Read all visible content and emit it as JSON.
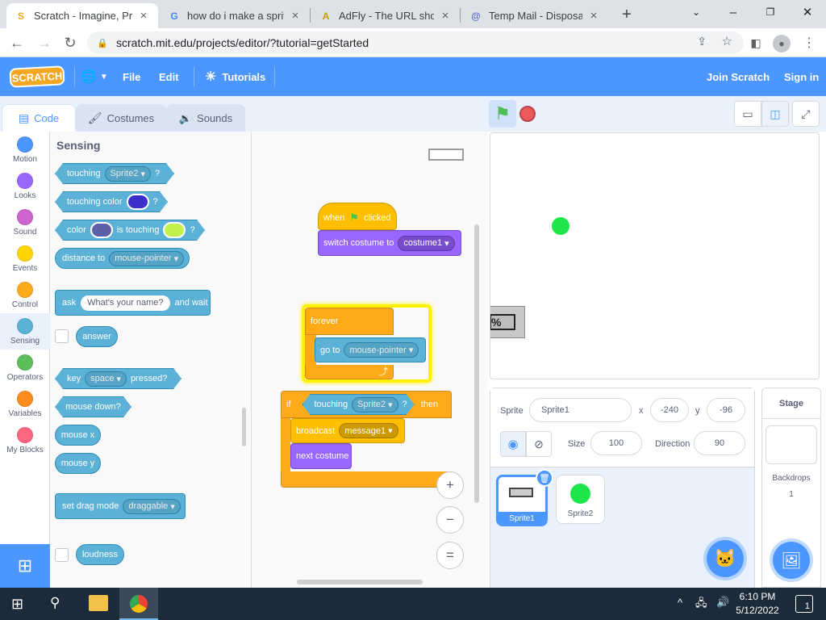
{
  "browser": {
    "tabs": [
      {
        "title": "Scratch - Imagine, Prog",
        "favicon": "S"
      },
      {
        "title": "how do i make a sprite",
        "favicon": "G"
      },
      {
        "title": "AdFly - The URL shorte",
        "favicon": "A"
      },
      {
        "title": "Temp Mail - Disposable",
        "favicon": "@"
      }
    ],
    "url": "scratch.mit.edu/projects/editor/?tutorial=getStarted",
    "icons": [
      "back-arrow-icon",
      "forward-arrow-icon",
      "reload-icon",
      "lock-icon",
      "share-icon",
      "star-icon",
      "sidebar-icon",
      "profile-icon",
      "kebab-menu-icon"
    ]
  },
  "menu": {
    "logo": "SCRATCH",
    "file": "File",
    "edit": "Edit",
    "tutorials": "Tutorials",
    "join": "Join Scratch",
    "signin": "Sign in"
  },
  "editor_tabs": {
    "code": "Code",
    "costumes": "Costumes",
    "sounds": "Sounds"
  },
  "categories": [
    {
      "label": "Motion",
      "color": "#4c97ff"
    },
    {
      "label": "Looks",
      "color": "#9966ff"
    },
    {
      "label": "Sound",
      "color": "#cf63cf"
    },
    {
      "label": "Events",
      "color": "#ffd500"
    },
    {
      "label": "Control",
      "color": "#ffab19"
    },
    {
      "label": "Sensing",
      "color": "#5cb1d6"
    },
    {
      "label": "Operators",
      "color": "#59c059"
    },
    {
      "label": "Variables",
      "color": "#ff8c1a"
    },
    {
      "label": "My Blocks",
      "color": "#ff6680"
    }
  ],
  "palette": {
    "heading": "Sensing",
    "touching": "touching",
    "touching_target": "Sprite2",
    "qmark": "?",
    "touching_color": "touching color",
    "color": "color",
    "is_touching": "is touching",
    "distance_to": "distance to",
    "distance_target": "mouse-pointer",
    "ask": "ask",
    "ask_default": "What's your name?",
    "and_wait": "and wait",
    "answer": "answer",
    "key": "key",
    "key_value": "space",
    "pressed": "pressed?",
    "mouse_down": "mouse down?",
    "mouse_x": "mouse x",
    "mouse_y": "mouse y",
    "set_drag": "set drag mode",
    "drag_value": "draggable",
    "loudness": "loudness",
    "swatch_colors": {
      "touching": "#3a2fc9",
      "color1": "#5d5fa8",
      "color2": "#c4f04a"
    }
  },
  "scripts": {
    "when": "when",
    "clicked": "clicked",
    "switch_costume": "switch costume to",
    "costume_value": "costume1",
    "forever": "forever",
    "go_to": "go to",
    "go_to_value": "mouse-pointer",
    "if": "if",
    "touching": "touching",
    "touching_value": "Sprite2",
    "qmark": "?",
    "then": "then",
    "broadcast": "broadcast",
    "broadcast_value": "message1",
    "next_costume": "next costume"
  },
  "zoom": {
    "in": "+",
    "out": "−",
    "reset": "="
  },
  "sprite_info": {
    "sprite_label": "Sprite",
    "sprite_name": "Sprite1",
    "x_label": "x",
    "x_value": "-240",
    "y_label": "y",
    "y_value": "-96",
    "size_label": "Size",
    "size_value": "100",
    "direction_label": "Direction",
    "direction_value": "90"
  },
  "sprites": [
    {
      "name": "Sprite1",
      "selected": true
    },
    {
      "name": "Sprite2",
      "selected": false
    }
  ],
  "stage_panel": {
    "title": "Stage",
    "backdrops_label": "Backdrops",
    "backdrops_count": "1"
  },
  "stage": {
    "partial_text": "%",
    "sprite2_color": "#1ee64a"
  },
  "taskbar": {
    "time": "6:10 PM",
    "date": "5/12/2022",
    "notifications": "1"
  }
}
